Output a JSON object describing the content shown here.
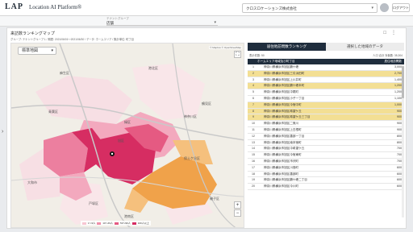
{
  "header": {
    "logo": "LAP",
    "product": "Location AI Platform®",
    "company": "クロスロケーションズ株式会社",
    "logout": "ログアウト"
  },
  "tenant": {
    "label": "テナントグループ",
    "value": "店舗"
  },
  "panel": {
    "title": "来訪数ランキングマップ",
    "description": "グループ: テナントグループ 1 / 期間: 2021/06/01〜2021/06/30 / データ: ホームエリア / 集計単位: 町丁目"
  },
  "map": {
    "type_select": "標準地図",
    "attribution": "© Mapbox © OpenStreetMap",
    "places": [
      {
        "name": "港北区"
      },
      {
        "name": "麻生区"
      },
      {
        "name": "青葉区"
      },
      {
        "name": "緑区"
      },
      {
        "name": "神奈川区"
      },
      {
        "name": "保土ケ谷区"
      },
      {
        "name": "旭区"
      },
      {
        "name": "鶴見区"
      },
      {
        "name": "大和市"
      },
      {
        "name": "戸塚区"
      },
      {
        "name": "港南区"
      },
      {
        "name": "磯子区"
      }
    ],
    "legend": [
      "1〜9人",
      "10〜49人",
      "50〜99人",
      "100人以上"
    ],
    "colors": {
      "low": "#f7c6d2",
      "mid": "#ef8fa9",
      "high": "#d62d62",
      "orange": "#f0a24a"
    }
  },
  "ranking": {
    "tab_active": "居住地訪問数ランキング",
    "tab_inactive": "選択した地域のデータ",
    "info_left": "表示件数: 50",
    "info_right": "人口 合計 対象数: 35,304",
    "col_area": "ホームエリア地域及び町丁目",
    "col_count": "居住地訪問数",
    "rows": [
      {
        "rank": "1",
        "area": "神奈川県横浜市旭区鶴ケ峰",
        "value": "3,000",
        "hl": false
      },
      {
        "rank": "2",
        "area": "神奈川県横浜市旭区三引浜田町",
        "value": "2,700",
        "hl": true
      },
      {
        "rank": "3",
        "area": "神奈川県横浜市旭区上川井町",
        "value": "1,400",
        "hl": false
      },
      {
        "rank": "4",
        "area": "神奈川県横浜市旭区鶴ケ峰本町",
        "value": "1,200",
        "hl": true
      },
      {
        "rank": "5",
        "area": "神奈川県横浜市旭区中尾町",
        "value": "1,200",
        "hl": false
      },
      {
        "rank": "6",
        "area": "神奈川県横浜市旭区小子一丁目",
        "value": "1,100",
        "hl": false
      },
      {
        "rank": "7",
        "area": "神奈川県横浜市旭区今宿中町",
        "value": "1,000",
        "hl": true
      },
      {
        "rank": "8",
        "area": "神奈川県横浜市旭区希望ケ丘",
        "value": "900",
        "hl": true
      },
      {
        "rank": "9",
        "area": "神奈川県横浜市旭区希望ケ丘三丁目",
        "value": "900",
        "hl": true
      },
      {
        "rank": "10",
        "area": "神奈川県横浜市旭区二俣川",
        "value": "900",
        "hl": false
      },
      {
        "rank": "11",
        "area": "神奈川県横浜市旭区上白根町",
        "value": "900",
        "hl": false
      },
      {
        "rank": "12",
        "area": "神奈川県横浜市旭区善部一丁目",
        "value": "800",
        "hl": false
      },
      {
        "rank": "13",
        "area": "神奈川県横浜市旭区南本宿町",
        "value": "800",
        "hl": false
      },
      {
        "rank": "14",
        "area": "神奈川県横浜市旭区中希望ケ丘",
        "value": "700",
        "hl": false
      },
      {
        "rank": "15",
        "area": "神奈川県横浜市旭区今宿東町",
        "value": "700",
        "hl": false
      },
      {
        "rank": "16",
        "area": "神奈川県横浜市旭区市沢町",
        "value": "700",
        "hl": false
      },
      {
        "rank": "17",
        "area": "神奈川県横浜市旭区川島町",
        "value": "600",
        "hl": false
      },
      {
        "rank": "18",
        "area": "神奈川県横浜市旭区善部町",
        "value": "600",
        "hl": false
      },
      {
        "rank": "19",
        "area": "神奈川県横浜市旭区鶴ケ峰二丁目",
        "value": "600",
        "hl": false
      },
      {
        "rank": "20",
        "area": "神奈川県横浜市旭区今川町",
        "value": "600",
        "hl": false
      }
    ]
  }
}
